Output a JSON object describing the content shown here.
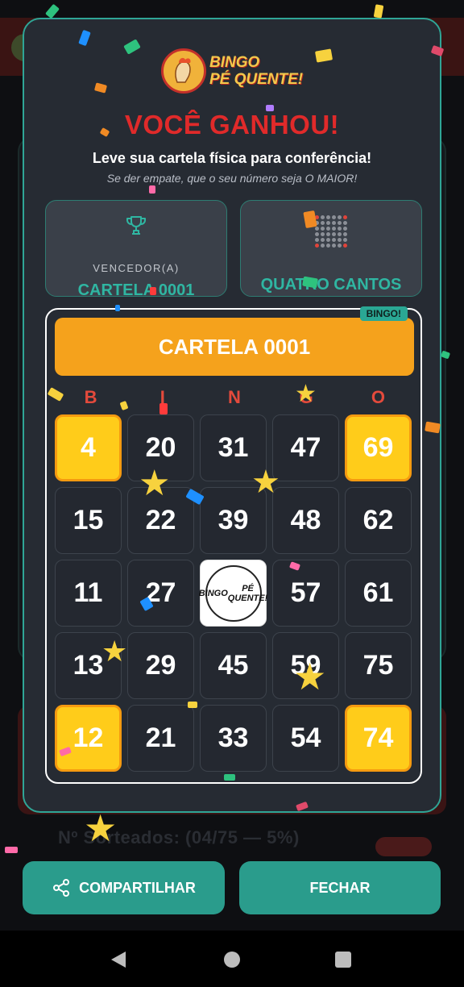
{
  "background": {
    "stats_text": "Nº Sorteados: (04/75 — 5%)"
  },
  "modal": {
    "logo_line1": "BINGO",
    "logo_line2": "PÉ QUENTE!",
    "title": "VOCÊ GANHOU!",
    "subtitle": "Leve sua cartela física para conferência!",
    "note": "Se der empate, que o seu número seja O MAIOR!",
    "winner_label": "VENCEDOR(A)",
    "winner_value": "CARTELA 0001",
    "pattern_value": "QUATRO CANTOS"
  },
  "card": {
    "tag": "BINGO!",
    "header": "CARTELA 0001",
    "letters": [
      "B",
      "I",
      "N",
      "G",
      "O"
    ],
    "free_logo_line1": "BINGO",
    "free_logo_line2": "PÉ QUENTE!",
    "rows": [
      [
        {
          "n": "4",
          "marked": true
        },
        {
          "n": "20"
        },
        {
          "n": "31"
        },
        {
          "n": "47"
        },
        {
          "n": "69",
          "marked": true
        }
      ],
      [
        {
          "n": "15"
        },
        {
          "n": "22"
        },
        {
          "n": "39"
        },
        {
          "n": "48"
        },
        {
          "n": "62"
        }
      ],
      [
        {
          "n": "11"
        },
        {
          "n": "27"
        },
        {
          "free": true
        },
        {
          "n": "57"
        },
        {
          "n": "61"
        }
      ],
      [
        {
          "n": "13"
        },
        {
          "n": "29"
        },
        {
          "n": "45"
        },
        {
          "n": "59"
        },
        {
          "n": "75"
        }
      ],
      [
        {
          "n": "12",
          "marked": true
        },
        {
          "n": "21"
        },
        {
          "n": "33"
        },
        {
          "n": "54"
        },
        {
          "n": "74",
          "marked": true
        }
      ]
    ]
  },
  "buttons": {
    "share": "COMPARTILHAR",
    "close": "FECHAR"
  },
  "colors": {
    "accent": "#2a9c8c",
    "title_red": "#e02a2a",
    "marked_yellow": "#ffcc1a",
    "header_orange": "#f5a21c"
  },
  "icons": {
    "winner": "trophy-icon",
    "pattern": "dot-grid-icon",
    "share": "share-icon"
  }
}
